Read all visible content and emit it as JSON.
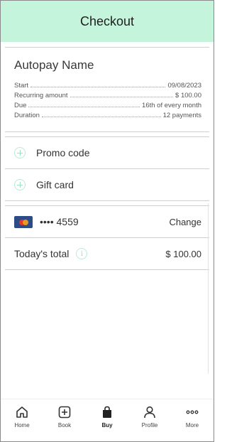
{
  "header": {
    "title": "Checkout"
  },
  "summary": {
    "name": "Autopay Name",
    "details": [
      {
        "label": "Start",
        "value": "09/08/2023"
      },
      {
        "label": "Recurring amount",
        "value": "$ 100.00"
      },
      {
        "label": "Due",
        "value": "16th of every month"
      },
      {
        "label": "Duration",
        "value": "12 payments"
      }
    ]
  },
  "options": {
    "promo_label": "Promo code",
    "gift_label": "Gift card"
  },
  "payment": {
    "card_number": "•••• 4559",
    "change_label": "Change"
  },
  "total": {
    "label": "Today's total",
    "info_glyph": "i",
    "amount": "$ 100.00"
  },
  "tabbar": {
    "items": [
      {
        "label": "Home",
        "icon": "home-icon"
      },
      {
        "label": "Book",
        "icon": "plus-square-icon"
      },
      {
        "label": "Buy",
        "icon": "shopping-bag-icon",
        "active": true
      },
      {
        "label": "Profile",
        "icon": "person-icon"
      },
      {
        "label": "More",
        "icon": "more-dots-icon"
      }
    ]
  },
  "colors": {
    "header_bg": "#c4f5dc",
    "accent": "#9fe3c3"
  }
}
